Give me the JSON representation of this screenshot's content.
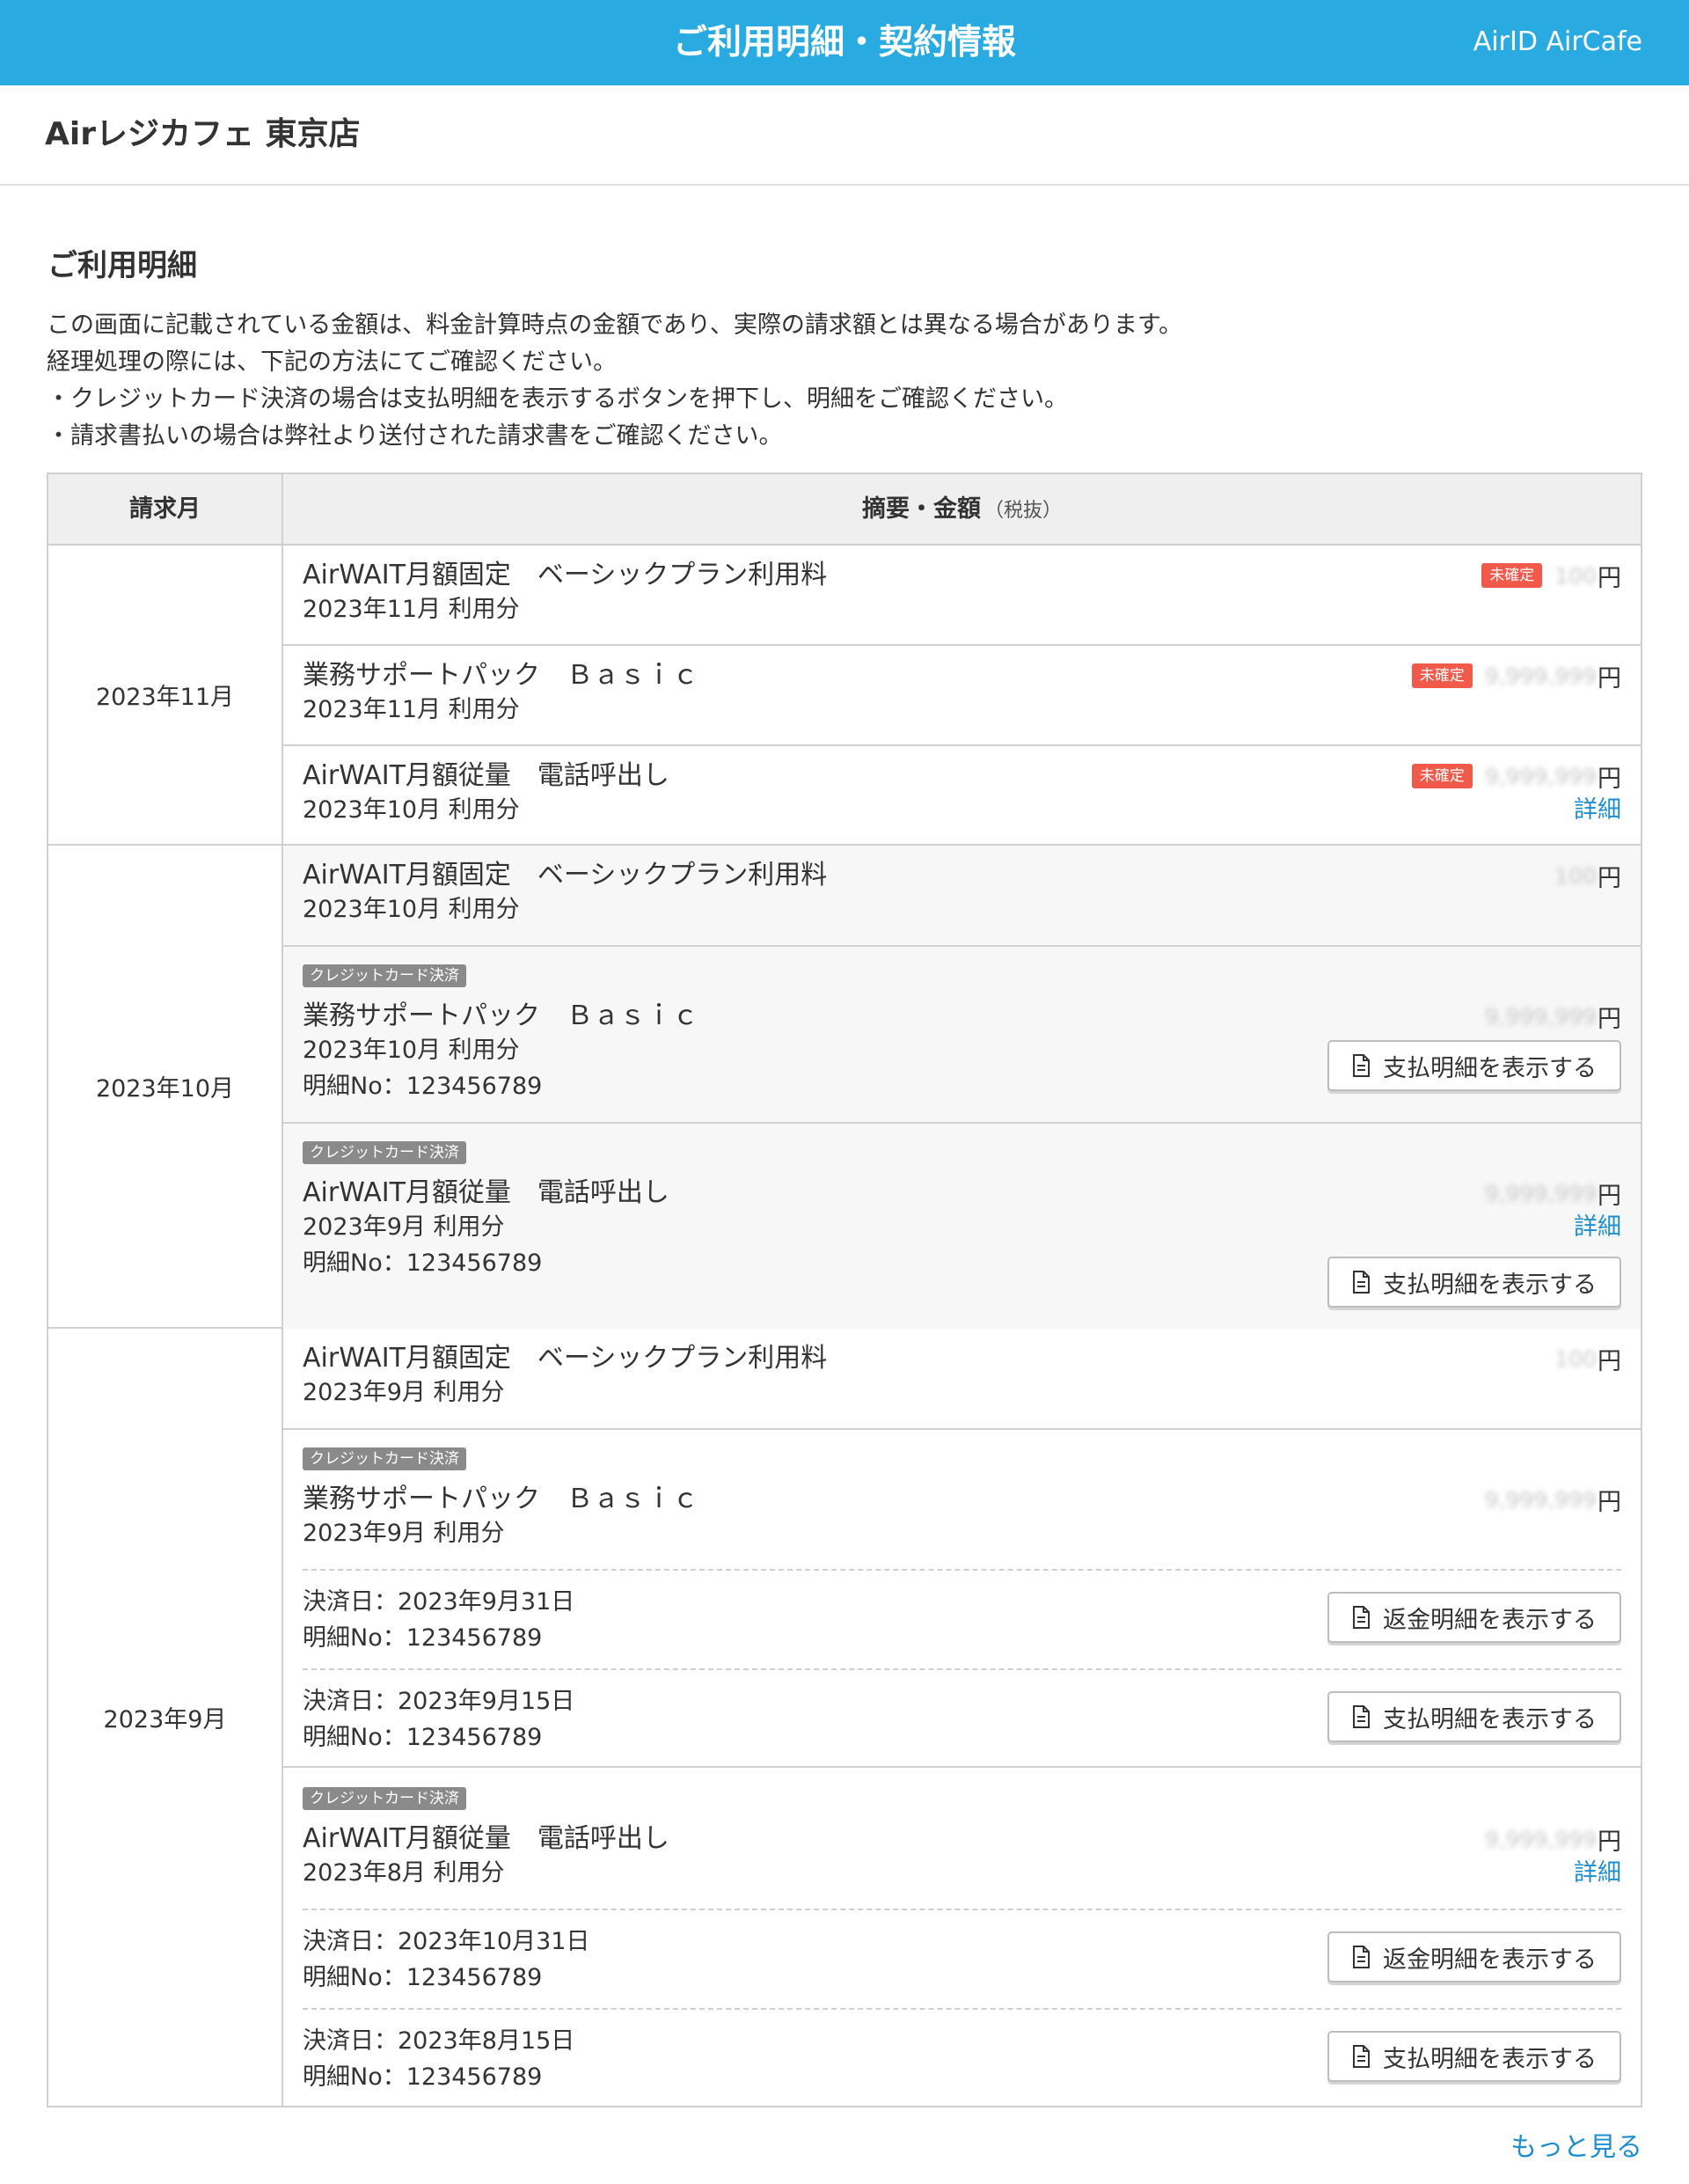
{
  "header": {
    "title": "ご利用明細・契約情報",
    "account": "AirID AirCafe",
    "bg_color": "#29abe2"
  },
  "store": {
    "name": "Airレジカフェ 東京店"
  },
  "section": {
    "title": "ご利用明細",
    "notes": [
      "この画面に記載されている金額は、料金計算時点の金額であり、実際の請求額とは異なる場合があります。",
      "経理処理の際には、下記の方法にてご確認ください。",
      "・クレジットカード決済の場合は支払明細を表示するボタンを押下し、明細をご確認ください。",
      "・請求書払いの場合は弊社より送付された請求書をご確認ください。"
    ]
  },
  "table": {
    "headers": {
      "month": "請求月",
      "desc": "摘要・金額",
      "tax_note": "（税抜）"
    },
    "groups": [
      {
        "month": "2023年11月",
        "items": [
          {
            "name": "AirWAIT月額固定　ベーシックプラン利用料",
            "period": "2023年11月 利用分",
            "status": "未確定",
            "amount": "100",
            "yen": "円"
          },
          {
            "name": "業務サポートパック　Ｂａｓｉｃ",
            "period": "2023年11月 利用分",
            "status": "未確定",
            "amount": "9,999,999",
            "yen": "円"
          },
          {
            "name": "AirWAIT月額従量　電話呼出し",
            "period": "2023年10月 利用分",
            "status": "未確定",
            "amount": "9,999,999",
            "yen": "円",
            "detail_link": "詳細"
          }
        ]
      },
      {
        "month": "2023年10月",
        "items": [
          {
            "name": "AirWAIT月額固定　ベーシックプラン利用料",
            "period": "2023年10月 利用分",
            "amount": "100",
            "yen": "円"
          },
          {
            "badge": "クレジットカード決済",
            "name": "業務サポートパック　Ｂａｓｉｃ",
            "period": "2023年10月 利用分",
            "statement_no": "明細No：123456789",
            "amount": "9,999,999",
            "yen": "円",
            "button": "支払明細を表示する"
          },
          {
            "badge": "クレジットカード決済",
            "name": "AirWAIT月額従量　電話呼出し",
            "period": "2023年9月 利用分",
            "statement_no": "明細No：123456789",
            "amount": "9,999,999",
            "yen": "円",
            "detail_link": "詳細",
            "button": "支払明細を表示する"
          }
        ]
      },
      {
        "month": "2023年9月",
        "items": [
          {
            "name": "AirWAIT月額固定　ベーシックプラン利用料",
            "period": "2023年9月 利用分",
            "amount": "100",
            "yen": "円"
          },
          {
            "badge": "クレジットカード決済",
            "name": "業務サポートパック　Ｂａｓｉｃ",
            "period": "2023年9月 利用分",
            "amount": "9,999,999",
            "yen": "円",
            "settlements": [
              {
                "date": "決済日：2023年9月31日",
                "statement_no": "明細No：123456789",
                "button": "返金明細を表示する"
              },
              {
                "date": "決済日：2023年9月15日",
                "statement_no": "明細No：123456789",
                "button": "支払明細を表示する"
              }
            ]
          },
          {
            "badge": "クレジットカード決済",
            "name": "AirWAIT月額従量　電話呼出し",
            "period": "2023年8月 利用分",
            "amount": "9,999,999",
            "yen": "円",
            "detail_link": "詳細",
            "settlements": [
              {
                "date": "決済日：2023年10月31日",
                "statement_no": "明細No：123456789",
                "button": "返金明細を表示する"
              },
              {
                "date": "決済日：2023年8月15日",
                "statement_no": "明細No：123456789",
                "button": "支払明細を表示する"
              }
            ]
          }
        ]
      }
    ]
  },
  "more_link": "もっと見る",
  "colors": {
    "accent": "#29abe2",
    "link": "#1d8ecf",
    "badge_unconfirmed": "#f15a4b",
    "badge_credit": "#8a8a8a"
  },
  "icons": {
    "button_icon": "document-icon"
  }
}
